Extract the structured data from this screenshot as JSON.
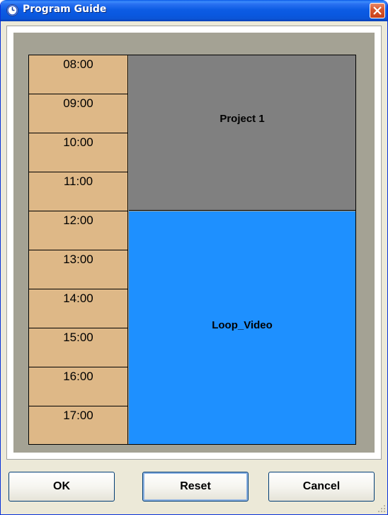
{
  "window": {
    "title": "Program Guide",
    "icon": "clock-icon"
  },
  "guide": {
    "time_slots": [
      "08:00",
      "09:00",
      "10:00",
      "11:00",
      "12:00",
      "13:00",
      "14:00",
      "15:00",
      "16:00",
      "17:00"
    ],
    "programs": [
      {
        "name": "Project 1",
        "color": "#808080"
      },
      {
        "name": "Loop_Video",
        "color": "#1e90ff"
      }
    ],
    "time_column_color": "#deb887"
  },
  "buttons": {
    "ok": "OK",
    "reset": "Reset",
    "cancel": "Cancel"
  }
}
